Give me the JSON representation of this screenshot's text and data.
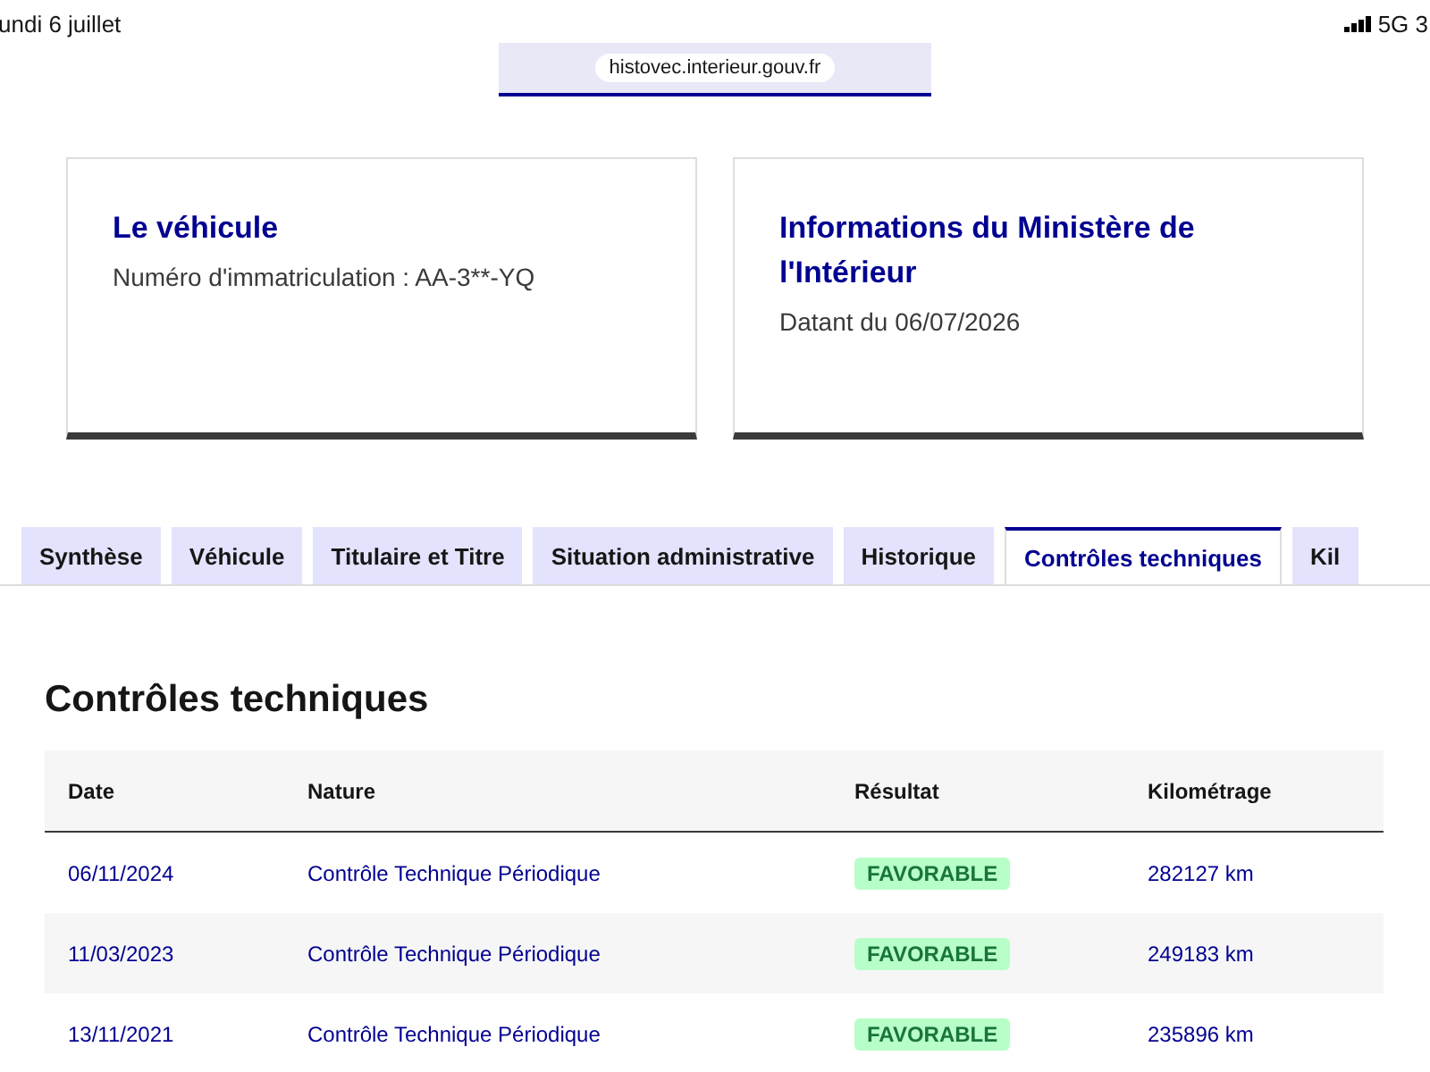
{
  "status_bar": {
    "date": "undi 6 juillet",
    "network": "5G 3"
  },
  "address_bar": {
    "url": "histovec.interieur.gouv.fr"
  },
  "cards": [
    {
      "title": "Le véhicule",
      "text": "Numéro d'immatriculation : AA-3**-YQ"
    },
    {
      "title": "Informations du Ministère de l'Intérieur",
      "text": "Datant du 06/07/2026"
    }
  ],
  "tabs": [
    {
      "label": "Synthèse",
      "selected": false
    },
    {
      "label": "Véhicule",
      "selected": false
    },
    {
      "label": "Titulaire et Titre",
      "selected": false
    },
    {
      "label": "Situation administrative",
      "selected": false
    },
    {
      "label": "Historique",
      "selected": false
    },
    {
      "label": "Contrôles techniques",
      "selected": true
    },
    {
      "label": "Kil",
      "selected": false
    }
  ],
  "section": {
    "title": "Contrôles techniques"
  },
  "table": {
    "columns": [
      "Date",
      "Nature",
      "Résultat",
      "Kilométrage"
    ],
    "rows": [
      {
        "date": "06/11/2024",
        "nature": "Contrôle Technique Périodique",
        "result": "FAVORABLE",
        "mileage": "282127 km"
      },
      {
        "date": "11/03/2023",
        "nature": "Contrôle Technique Périodique",
        "result": "FAVORABLE",
        "mileage": "249183 km"
      },
      {
        "date": "13/11/2021",
        "nature": "Contrôle Technique Périodique",
        "result": "FAVORABLE",
        "mileage": "235896 km"
      }
    ]
  }
}
